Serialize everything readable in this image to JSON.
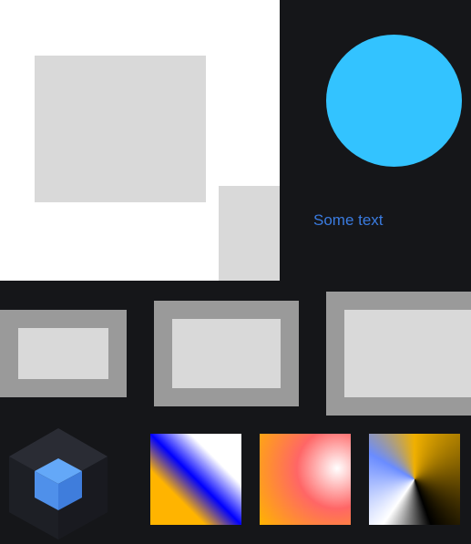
{
  "label": {
    "text": "Some text",
    "color": "#3a7bdf"
  },
  "icons": {
    "cube": "cube-logo-icon"
  },
  "colors": {
    "background": "#151619",
    "panel": "#ffffff",
    "light_gray": "#d9d9d9",
    "frame_gray": "#9a9a9a",
    "circle": "#33c3ff",
    "cube_blue": "#5aa0f5"
  },
  "gradients": {
    "linear": [
      "#ffb400",
      "#0000ff",
      "#ffffff"
    ],
    "radial": [
      "#ffffff",
      "#ff6666",
      "#ffb400"
    ],
    "conic": [
      "#f0b000",
      "#000000",
      "#ffffff",
      "#6a8cff"
    ]
  }
}
